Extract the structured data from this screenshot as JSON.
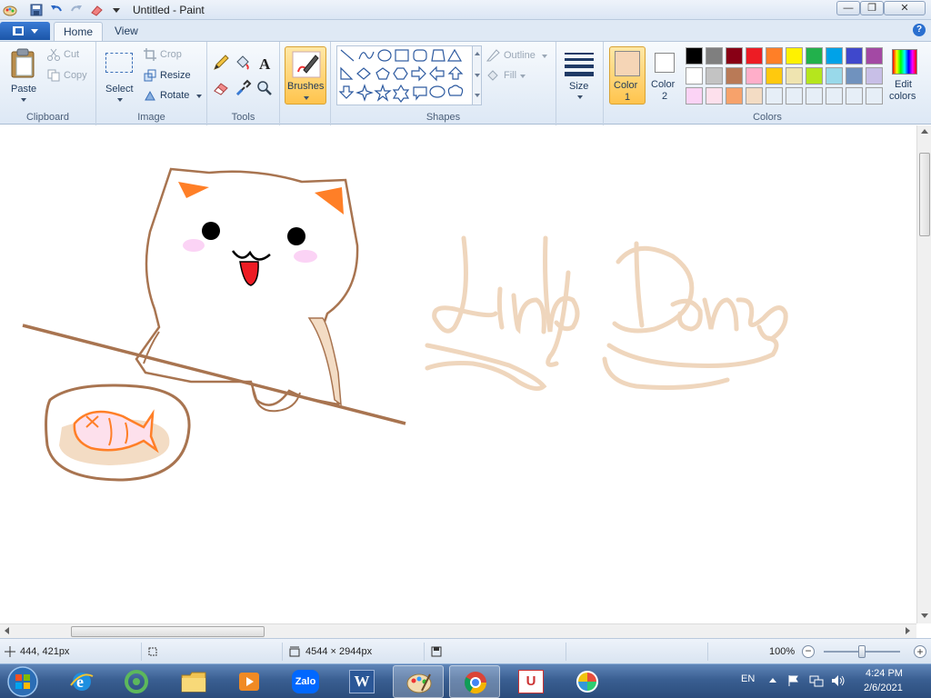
{
  "window": {
    "title": "Untitled - Paint",
    "controls": {
      "minimize": "—",
      "maximize": "❐",
      "close": "✕"
    }
  },
  "ribbon_tabs": {
    "home": "Home",
    "view": "View"
  },
  "help_label": "?",
  "clipboard": {
    "group_label": "Clipboard",
    "paste": "Paste",
    "cut": "Cut",
    "copy": "Copy"
  },
  "image": {
    "group_label": "Image",
    "select": "Select",
    "crop": "Crop",
    "resize": "Resize",
    "rotate": "Rotate"
  },
  "tools": {
    "group_label": "Tools",
    "items": [
      "pencil-icon",
      "fill-bucket-icon",
      "text-icon",
      "eraser-icon",
      "color-picker-icon",
      "magnifier-icon"
    ]
  },
  "brushes": {
    "label": "Brushes"
  },
  "shapes": {
    "group_label": "Shapes",
    "outline": "Outline",
    "fill": "Fill",
    "items": [
      "line",
      "curve",
      "oval",
      "rectangle",
      "rounded-rectangle",
      "polygon",
      "triangle",
      "right-triangle",
      "diamond",
      "pentagon",
      "hexagon",
      "right-arrow",
      "left-arrow",
      "up-arrow",
      "down-arrow",
      "four-point-star",
      "five-point-star",
      "six-point-star",
      "rounded-callout",
      "oval-callout",
      "cloud-callout"
    ]
  },
  "size": {
    "label": "Size"
  },
  "colors": {
    "group_label": "Colors",
    "color1_label": "Color\n1",
    "color1_line1": "Color",
    "color1_line2": "1",
    "color2_line1": "Color",
    "color2_line2": "2",
    "color1_value": "#f5d5b6",
    "color2_value": "#ffffff",
    "edit_line1": "Edit",
    "edit_line2": "colors",
    "palette": [
      "#000000",
      "#7f7f7f",
      "#880015",
      "#ed1c24",
      "#ff7f27",
      "#fff200",
      "#22b14c",
      "#00a2e8",
      "#3f48cc",
      "#a349a4",
      "#ffffff",
      "#c3c3c3",
      "#b97a57",
      "#ffaec9",
      "#ffc90e",
      "#efe4b0",
      "#b5e61d",
      "#99d9ea",
      "#7092be",
      "#c8bfe7",
      "#fbd3f5",
      "#fde0ec",
      "#f7a26b",
      "#f3dcc4",
      "#e6eef7",
      "#e6eef7",
      "#e6eef7",
      "#e6eef7",
      "#e6eef7",
      "#e6eef7"
    ]
  },
  "canvas": {
    "drawing_text": "Linh Dan"
  },
  "status": {
    "cursor_pos": "444, 421px",
    "selection_size": "",
    "image_size": "4544 × 2944px",
    "zoom": "100%",
    "zoom_level": 0.5
  },
  "taskbar": {
    "apps": [
      "start-orb",
      "internet-explorer",
      "coccoc-browser",
      "file-explorer",
      "media-player",
      "zalo",
      "word",
      "paint",
      "chrome",
      "unikey",
      "photo-app"
    ],
    "zalo_label": "Zalo",
    "word_label": "W",
    "unikey_label": "U",
    "language": "EN",
    "time": "4:24 PM",
    "date": "2/6/2021"
  }
}
